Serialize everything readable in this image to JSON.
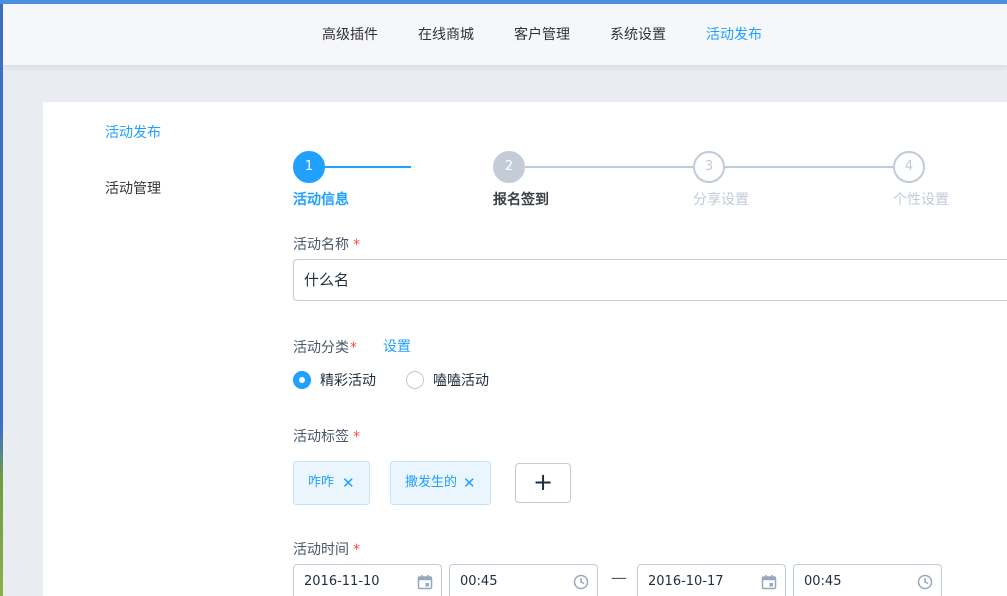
{
  "colors": {
    "accent": "#20a0ff",
    "required": "#ff4949",
    "border": "#bfcbd9",
    "topbar": "#4a90e2"
  },
  "topnav": {
    "items": [
      {
        "label": "高级插件",
        "active": false
      },
      {
        "label": "在线商城",
        "active": false
      },
      {
        "label": "客户管理",
        "active": false
      },
      {
        "label": "系统设置",
        "active": false
      },
      {
        "label": "活动发布",
        "active": true
      }
    ]
  },
  "sidebar": {
    "items": [
      {
        "label": "活动发布",
        "active": true
      },
      {
        "label": "活动管理",
        "active": false
      }
    ]
  },
  "steps": [
    {
      "number": "1",
      "title": "活动信息",
      "state": "current"
    },
    {
      "number": "2",
      "title": "报名签到",
      "state": "process"
    },
    {
      "number": "3",
      "title": "分享设置",
      "state": "wait"
    },
    {
      "number": "4",
      "title": "个性设置",
      "state": "wait"
    }
  ],
  "form": {
    "name": {
      "label": "活动名称",
      "required": "*",
      "value": "什么名"
    },
    "category": {
      "label": "活动分类",
      "required": "*",
      "settings_link": "设置",
      "options": [
        {
          "label": "精彩活动",
          "checked": true
        },
        {
          "label": "嗑嗑活动",
          "checked": false
        }
      ]
    },
    "tags": {
      "label": "活动标签",
      "required": "*",
      "items": [
        {
          "label": "咋咋",
          "close": "✕"
        },
        {
          "label": "撒发生的",
          "close": "✕"
        }
      ],
      "add_label": "+"
    },
    "time": {
      "label": "活动时间",
      "required": "*",
      "start_date": "2016-11-10",
      "start_time": "00:45",
      "separator": "—",
      "end_date": "2016-10-17",
      "end_time": "00:45",
      "date_icon": "calendar-icon",
      "time_icon": "clock-icon"
    }
  }
}
